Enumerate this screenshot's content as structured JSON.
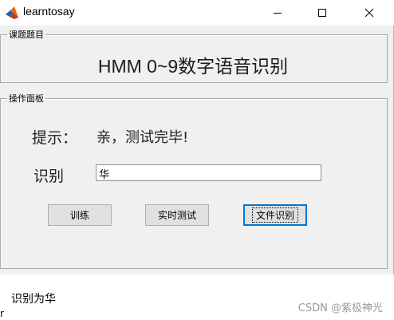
{
  "window": {
    "title": "learntosay",
    "app_icon": "matlab-icon",
    "controls": [
      "minimize-icon",
      "maximize-icon",
      "close-icon"
    ]
  },
  "title_group": {
    "legend": "课题题目",
    "heading": "HMM 0~9数字语音识别"
  },
  "ops_group": {
    "legend": "操作面板",
    "hint_label": "提示：",
    "hint_value": "亲，测试完毕!",
    "recog_label": "识别",
    "recog_value": "华",
    "buttons": {
      "train": "训练",
      "realtime": "实时测试",
      "file": "文件识别"
    }
  },
  "console": {
    "output_line": "识别为华",
    "edge_char": "r"
  },
  "watermark": "CSDN @紫极神光",
  "colors": {
    "window_bg": "#f0f0f0",
    "focus_border": "#0078d7",
    "button_bg": "#e1e1e1"
  }
}
